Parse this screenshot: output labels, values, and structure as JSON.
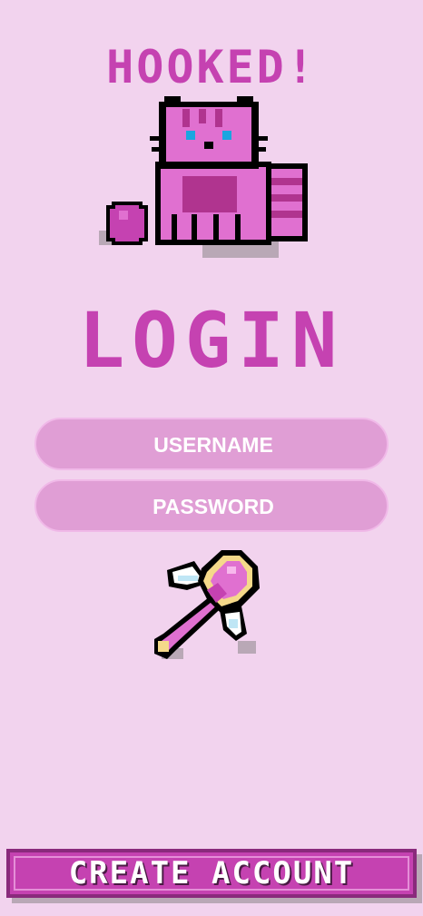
{
  "app": {
    "title": "HOOKED!"
  },
  "illustrations": {
    "top": "pixel-cat-with-yarn-icon",
    "middle": "pixel-heart-wand-icon"
  },
  "login": {
    "heading": "LOGIN",
    "username_placeholder": "USERNAME",
    "password_placeholder": "PASSWORD"
  },
  "footer": {
    "create_account_label": "CREATE ACCOUNT"
  },
  "colors": {
    "background": "#f2d3ee",
    "accent": "#c542b1",
    "field": "#e09ed5",
    "button_border": "#8a2a7c"
  }
}
